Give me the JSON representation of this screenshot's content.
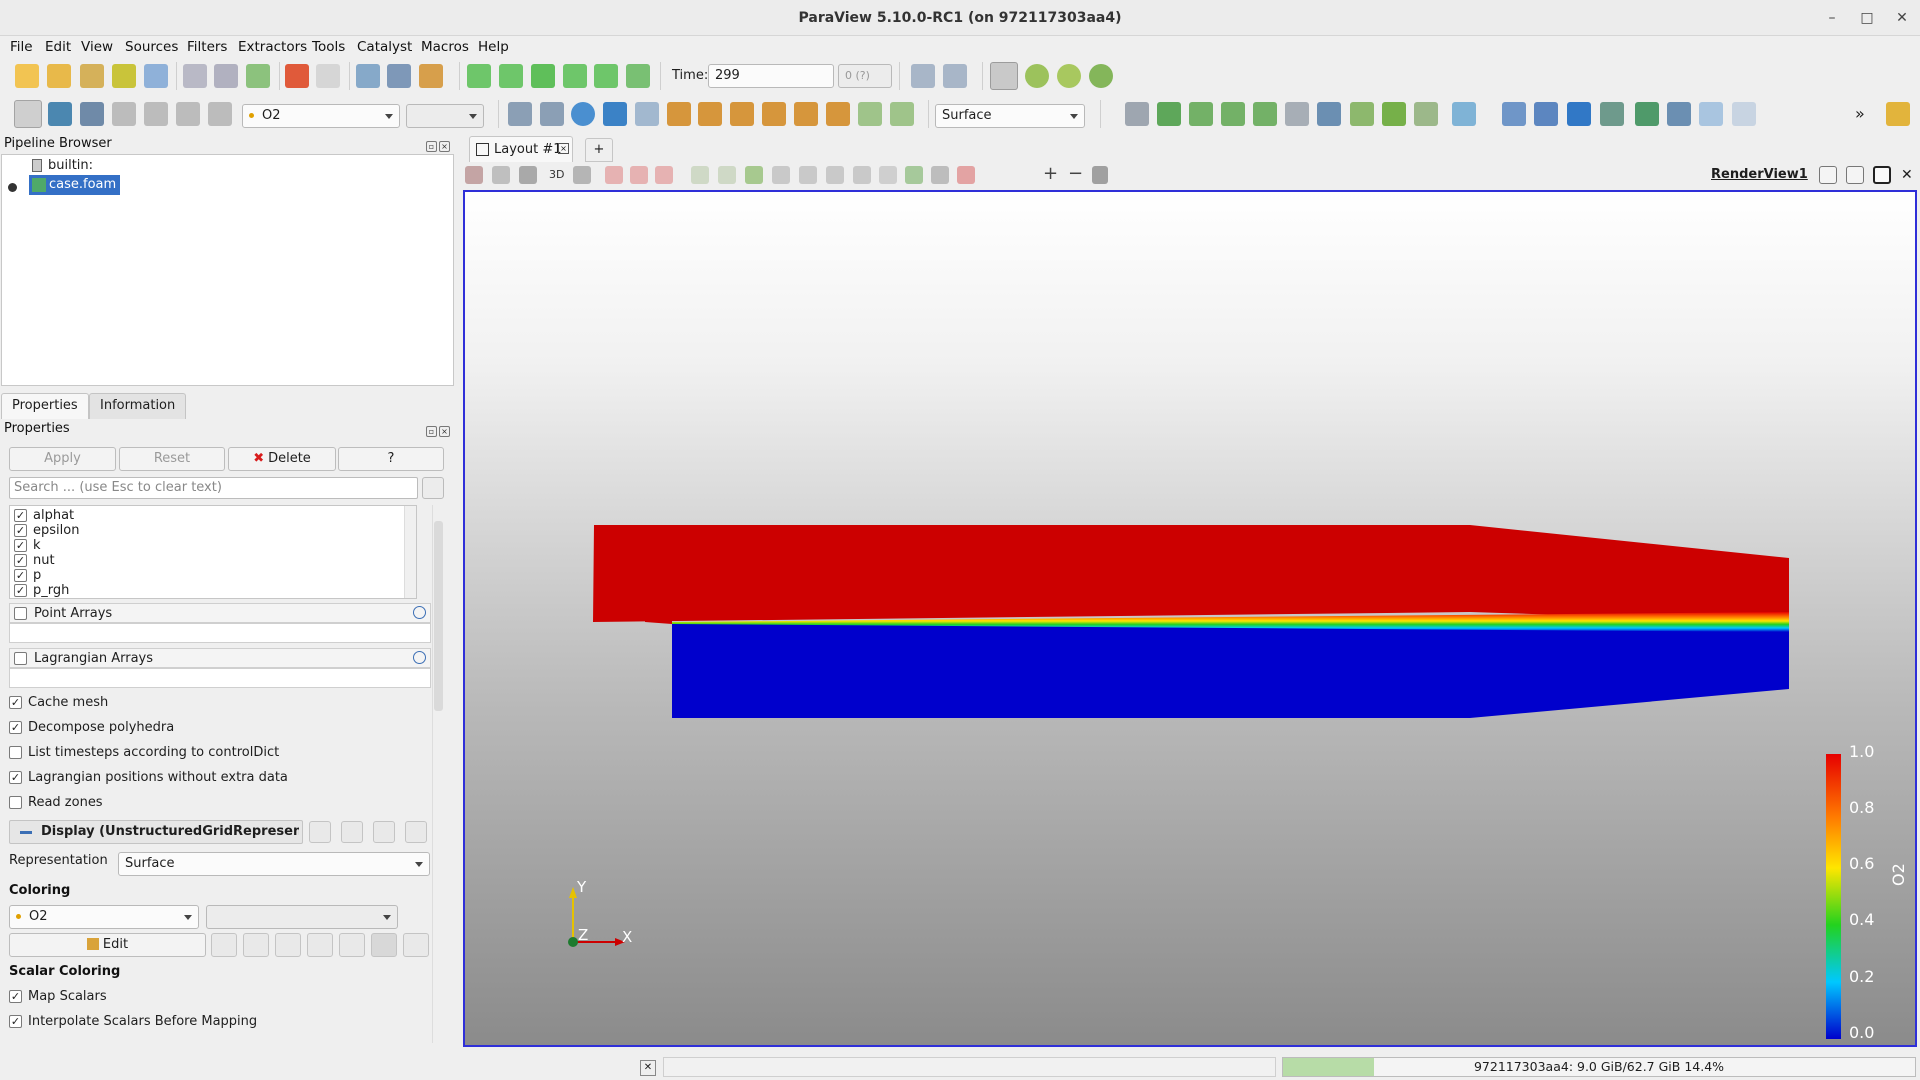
{
  "window": {
    "title": "ParaView 5.10.0-RC1 (on 972117303aa4)",
    "minimize": "–",
    "maximize": "□",
    "close": "✕"
  },
  "menu": [
    "File",
    "Edit",
    "View",
    "Sources",
    "Filters",
    "Extractors",
    "Tools",
    "Catalyst",
    "Macros",
    "Help"
  ],
  "time_toolbar": {
    "time_label": "Time:",
    "time_value": "299",
    "timestep_value": "0 (?)"
  },
  "toolbar2": {
    "array_combo": "O2",
    "representation_combo": "Surface"
  },
  "pipeline": {
    "title": "Pipeline Browser",
    "root": "builtin:",
    "items": [
      "case.foam"
    ]
  },
  "properties_tabs": [
    "Properties",
    "Information"
  ],
  "properties": {
    "title": "Properties",
    "apply": "Apply",
    "reset": "Reset",
    "delete": "Delete",
    "help": "?",
    "search_placeholder": "Search ... (use Esc to clear text)",
    "cell_arrays": [
      "alphat",
      "epsilon",
      "k",
      "nut",
      "p",
      "p_rgh"
    ],
    "point_arrays": "Point Arrays",
    "lagrangian_arrays": "Lagrangian Arrays",
    "options": [
      {
        "label": "Cache mesh",
        "checked": true
      },
      {
        "label": "Decompose polyhedra",
        "checked": true
      },
      {
        "label": "List timesteps according to controlDict",
        "checked": false
      },
      {
        "label": "Lagrangian positions without extra data",
        "checked": true
      },
      {
        "label": "Read zones",
        "checked": false
      }
    ],
    "display_section": "Display (UnstructuredGridRepresenta",
    "representation_label": "Representation",
    "representation_value": "Surface",
    "coloring_label": "Coloring",
    "coloring_value": "O2",
    "edit_label": "Edit",
    "scalar_coloring_label": "Scalar Coloring",
    "scalar_options": [
      {
        "label": "Map Scalars",
        "checked": true
      },
      {
        "label": "Interpolate Scalars Before Mapping",
        "checked": true
      }
    ]
  },
  "layout": {
    "tab_label": "Layout #1",
    "add_tab": "+",
    "view_name": "RenderView1",
    "toolbar_3d": "3D"
  },
  "colorbar": {
    "title": "O2",
    "ticks": [
      "1.0",
      "0.8",
      "0.6",
      "0.4",
      "0.2",
      "0.0"
    ],
    "colors": [
      "#e60000",
      "#ff7a00",
      "#ffe600",
      "#23d21e",
      "#00c8ff",
      "#0000cc"
    ]
  },
  "axes": {
    "y": "Y",
    "z": "Z",
    "x": "X"
  },
  "status": {
    "memory_text": "972117303aa4: 9.0 GiB/62.7 GiB 14.4%",
    "memory_percent": 14.4
  }
}
